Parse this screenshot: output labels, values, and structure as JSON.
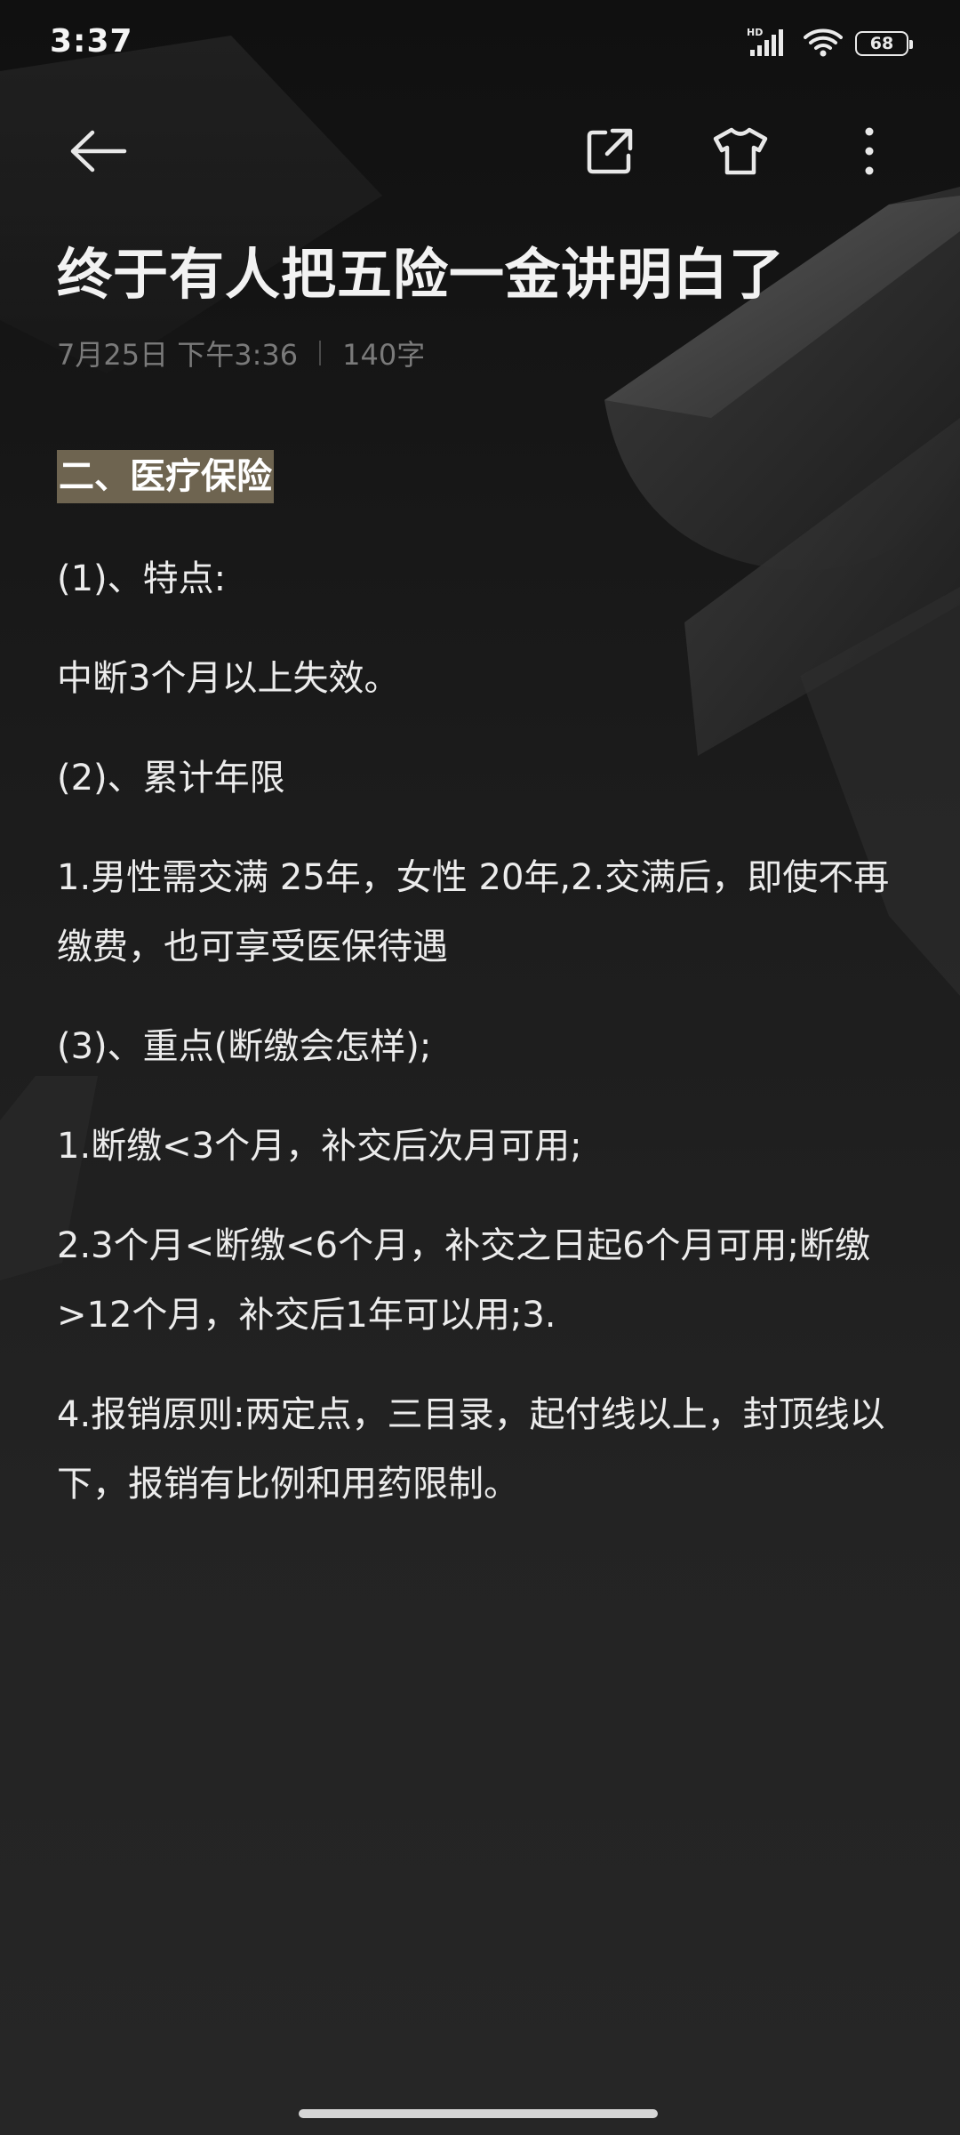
{
  "status_bar": {
    "time": "3:37",
    "network": "HD",
    "battery": "68"
  },
  "toolbar": {
    "back_icon": "back-arrow-icon",
    "share_icon": "share-icon",
    "theme_icon": "tshirt-icon",
    "more_icon": "more-vertical-icon"
  },
  "note": {
    "title": "终于有人把五险一金讲明白了",
    "date": "7月25日 下午3:36",
    "word_count": "140字",
    "heading": "二、医疗保险",
    "paragraphs": [
      "(1)、特点:",
      "中断3个月以上失效。",
      "(2)、累计年限",
      "1.男性需交满 25年，女性 20年,2.交满后，即使不再缴费，也可享受医保待遇",
      "(3)、重点(断缴会怎样);",
      "1.断缴<3个月，补交后次月可用;",
      "2.3个月<断缴<6个月，补交之日起6个月可用;断缴>12个月，补交后1年可以用;3.",
      "4.报销原则:两定点，三目录，起付线以上，封顶线以下，报销有比例和用药限制。"
    ]
  },
  "colors": {
    "background": "#1e1e1e",
    "highlight": "#6e6450",
    "meta_text": "#7a7a7a"
  }
}
